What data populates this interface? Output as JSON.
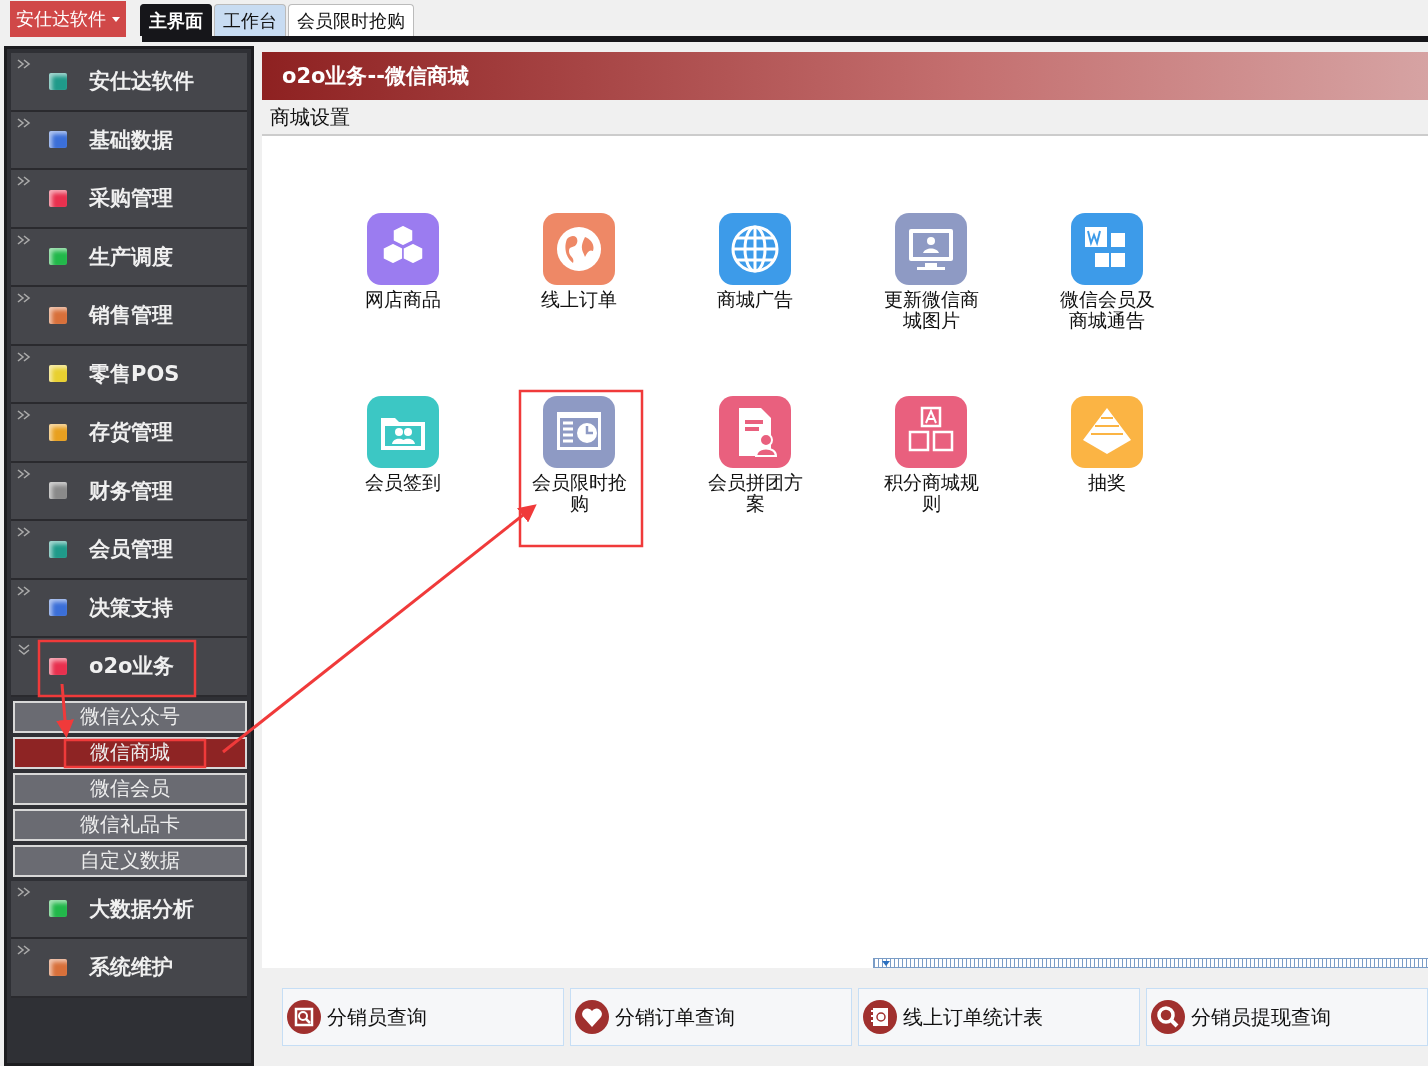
{
  "brand_menu": {
    "label": "安仕达软件"
  },
  "tabs": [
    {
      "label": "主界面",
      "selected": true,
      "highlighted": false
    },
    {
      "label": "工作台",
      "selected": false,
      "highlighted": true
    },
    {
      "label": "会员限时抢购",
      "selected": false,
      "highlighted": false
    }
  ],
  "sidebar": {
    "items": [
      {
        "label": "安仕达软件",
        "color": "#1f9a8a",
        "expanded": false
      },
      {
        "label": "基础数据",
        "color": "#3b6fd8",
        "expanded": false
      },
      {
        "label": "采购管理",
        "color": "#e8304e",
        "expanded": false
      },
      {
        "label": "生产调度",
        "color": "#22b84a",
        "expanded": false
      },
      {
        "label": "销售管理",
        "color": "#d8703a",
        "expanded": false
      },
      {
        "label": "零售POS",
        "color": "#e8d030",
        "expanded": false
      },
      {
        "label": "存货管理",
        "color": "#e8a020",
        "expanded": false
      },
      {
        "label": "财务管理",
        "color": "#8a8a8a",
        "expanded": false
      },
      {
        "label": "会员管理",
        "color": "#1f9a8a",
        "expanded": false
      },
      {
        "label": "决策支持",
        "color": "#3b6fd8",
        "expanded": false
      },
      {
        "label": "o2o业务",
        "color": "#e8304e",
        "expanded": true,
        "children": [
          {
            "label": "微信公众号",
            "selected": false
          },
          {
            "label": "微信商城",
            "selected": true
          },
          {
            "label": "微信会员",
            "selected": false
          },
          {
            "label": "微信礼品卡",
            "selected": false
          },
          {
            "label": "自定义数据",
            "selected": false
          }
        ]
      },
      {
        "label": "大数据分析",
        "color": "#22b84a",
        "expanded": false
      },
      {
        "label": "系统维护",
        "color": "#d8703a",
        "expanded": false
      }
    ]
  },
  "panel": {
    "title": "o2o业务--微信商城",
    "section": "商城设置",
    "tiles": [
      {
        "label": "网店商品",
        "color": "#9b7cf0"
      },
      {
        "label": "线上订单",
        "color": "#ee8866"
      },
      {
        "label": "商城广告",
        "color": "#3d9be9"
      },
      {
        "label": "更新微信商城图片",
        "color": "#8e9ac4"
      },
      {
        "label": "微信会员及商城通告",
        "color": "#3d9be9"
      },
      {
        "label": "会员签到",
        "color": "#3cc7c4"
      },
      {
        "label": "会员限时抢购",
        "color": "#8e9ac4"
      },
      {
        "label": "会员拼团方案",
        "color": "#e9607e"
      },
      {
        "label": "积分商城规则",
        "color": "#e9607e"
      },
      {
        "label": "抽奖",
        "color": "#fbb444"
      }
    ]
  },
  "bottom_links": [
    {
      "label": "分销员查询"
    },
    {
      "label": "分销订单查询"
    },
    {
      "label": "线上订单统计表"
    },
    {
      "label": "分销员提现查询"
    }
  ]
}
